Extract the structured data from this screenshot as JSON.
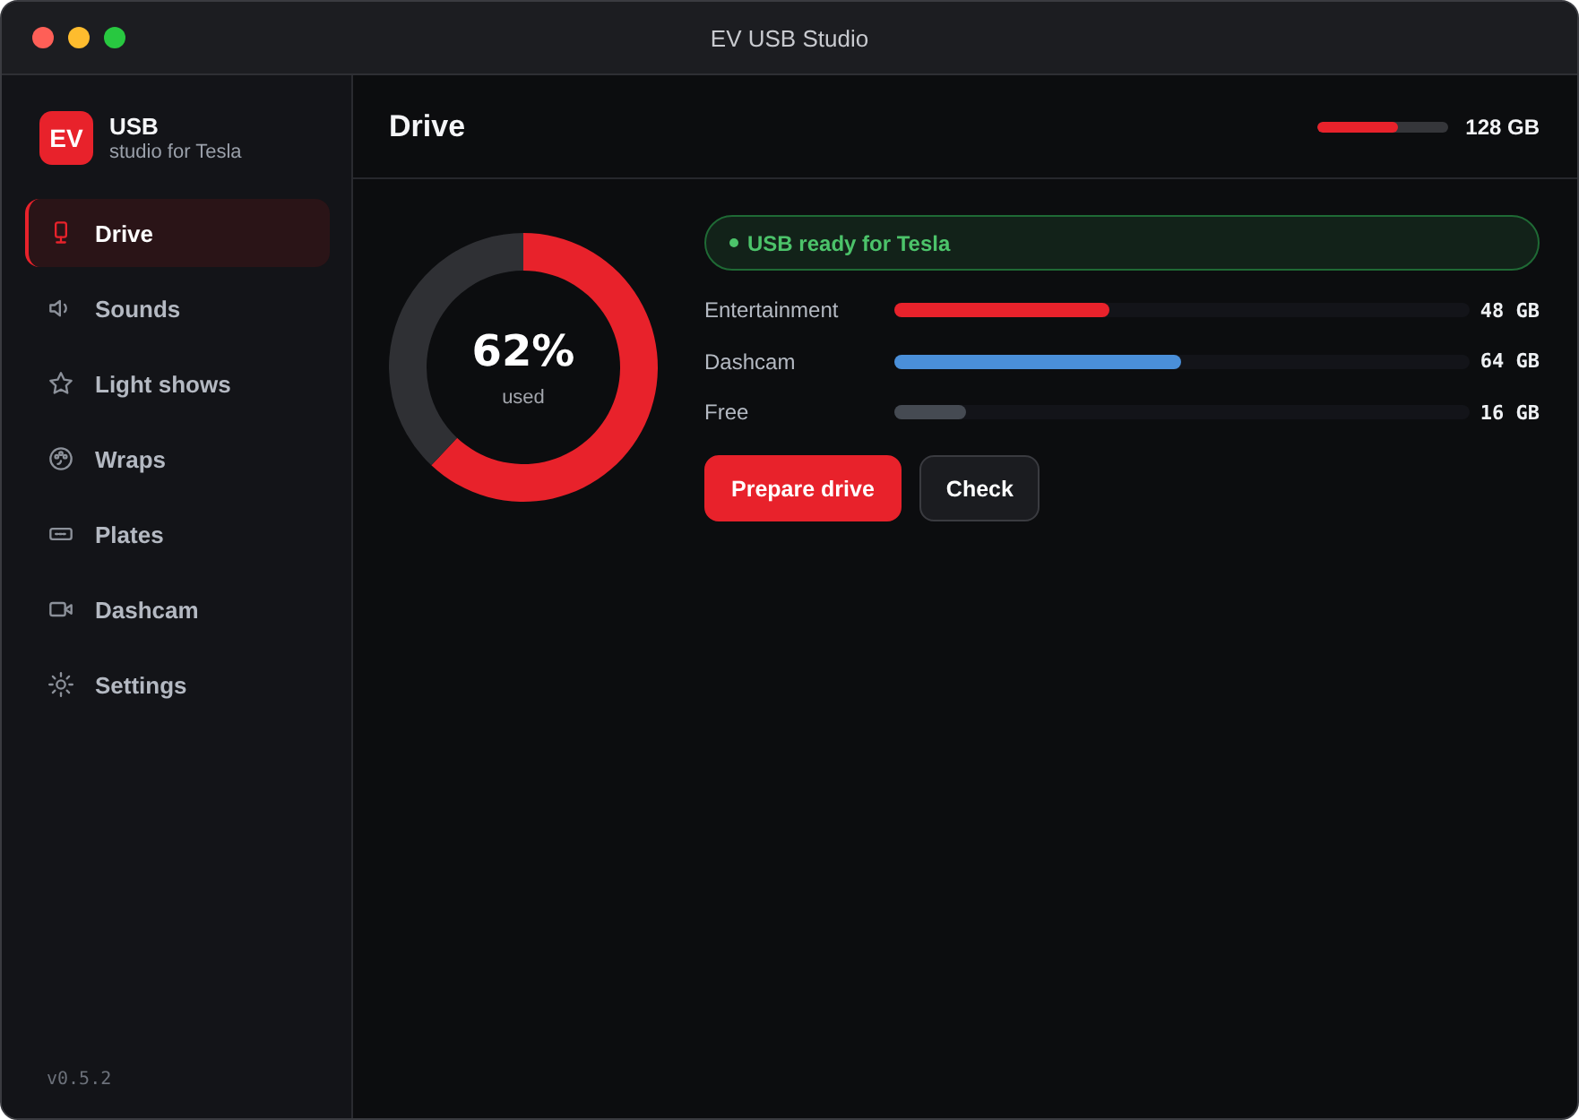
{
  "window": {
    "title": "EV USB Studio"
  },
  "sidebar": {
    "logo": {
      "mark": "EV",
      "name": "USB",
      "subtitle": "studio for Tesla"
    },
    "items": [
      {
        "label": "Drive",
        "selected": true
      },
      {
        "label": "Sounds",
        "selected": false
      },
      {
        "label": "Light shows",
        "selected": false
      },
      {
        "label": "Wraps",
        "selected": false
      },
      {
        "label": "Plates",
        "selected": false
      },
      {
        "label": "Dashcam",
        "selected": false
      },
      {
        "label": "Settings",
        "selected": false
      }
    ],
    "version": "v0.5.2"
  },
  "header": {
    "title": "Drive",
    "capacity": {
      "level": 0.62,
      "label": "128 GB"
    }
  },
  "usage": {
    "chart_data": {
      "type": "donut",
      "values": [
        62,
        38
      ]
    },
    "percent": "62%",
    "caption": "used"
  },
  "status": {
    "text": "USB ready for Tesla"
  },
  "categories": [
    {
      "label": "Entertainment",
      "level": 0.375,
      "color": "#e8222b",
      "size": "48 GB"
    },
    {
      "label": "Dashcam",
      "level": 0.5,
      "color": "#4a8fd9",
      "size": "64 GB"
    },
    {
      "label": "Free",
      "level": 0.125,
      "color": "#454a52",
      "size": "16 GB"
    }
  ],
  "buttons": [
    {
      "label": "Prepare drive",
      "kind": "primary"
    },
    {
      "label": "Check",
      "kind": "secondary"
    }
  ]
}
